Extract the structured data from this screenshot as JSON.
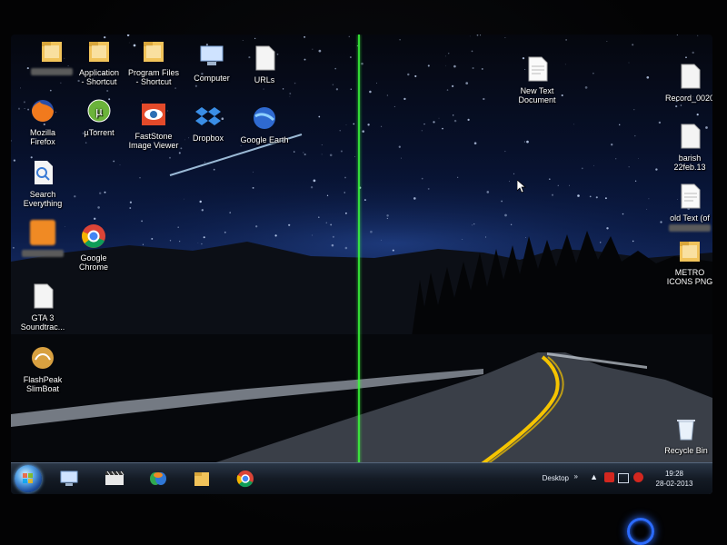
{
  "desktop": {
    "icons_left": [
      {
        "key": "user-folder",
        "label": "",
        "label2": "",
        "icon": "folder-icon",
        "blurred": true
      },
      {
        "key": "application-shortcut",
        "label": "Application",
        "label2": "- Shortcut",
        "icon": "folder-icon",
        "blurred": false
      },
      {
        "key": "program-files-shortcut",
        "label": "Program Files",
        "label2": "- Shortcut",
        "icon": "folder-icon",
        "blurred": false
      },
      {
        "key": "computer",
        "label": "Computer",
        "label2": "",
        "icon": "computer-icon",
        "blurred": false
      },
      {
        "key": "urls",
        "label": "URLs",
        "label2": "",
        "icon": "document-icon",
        "blurred": false
      },
      {
        "key": "mozilla-firefox",
        "label": "Mozilla",
        "label2": "Firefox",
        "icon": "firefox-icon",
        "blurred": false
      },
      {
        "key": "utorrent",
        "label": "µTorrent",
        "label2": "",
        "icon": "utorrent-icon",
        "blurred": false
      },
      {
        "key": "faststone",
        "label": "FastStone",
        "label2": "Image Viewer",
        "icon": "faststone-eye-icon",
        "blurred": false
      },
      {
        "key": "dropbox",
        "label": "Dropbox",
        "label2": "",
        "icon": "dropbox-icon",
        "blurred": false
      },
      {
        "key": "google-earth",
        "label": "Google Earth",
        "label2": "",
        "icon": "google-earth-icon",
        "blurred": false
      },
      {
        "key": "search-everything",
        "label": "Search",
        "label2": "Everything",
        "icon": "search-everything-icon",
        "blurred": false
      },
      {
        "key": "blurred-item",
        "label": "",
        "label2": "",
        "icon": "orange-app-icon",
        "blurred": true
      },
      {
        "key": "google-chrome",
        "label": "Google",
        "label2": "Chrome",
        "icon": "chrome-icon",
        "blurred": false
      },
      {
        "key": "gta3",
        "label": "GTA 3",
        "label2": "Soundtrac...",
        "icon": "document-icon",
        "blurred": false
      },
      {
        "key": "flashpeak",
        "label": "FlashPeak",
        "label2": "SlimBoat",
        "icon": "slimboat-icon",
        "blurred": false
      }
    ],
    "icons_right": [
      {
        "key": "new-text-document",
        "label": "New Text",
        "label2": "Document",
        "icon": "text-document-icon"
      },
      {
        "key": "record",
        "label": "Record_0020",
        "label2": "",
        "icon": "document-icon"
      },
      {
        "key": "barish",
        "label": "barish",
        "label2": "22feb.13",
        "icon": "document-icon"
      },
      {
        "key": "old-text",
        "label": "old Text (of",
        "label2": "",
        "icon": "text-document-icon",
        "blurred": true
      },
      {
        "key": "metro-icons",
        "label": "METRO",
        "label2": "ICONS PNG",
        "icon": "folder-icon"
      },
      {
        "key": "recycle-bin",
        "label": "Recycle Bin",
        "label2": "",
        "icon": "recycle-bin-icon"
      }
    ]
  },
  "taskbar": {
    "pinned": [
      {
        "name": "start-button",
        "icon": "windows-orb-icon"
      },
      {
        "name": "computer",
        "icon": "computer-icon"
      },
      {
        "name": "media",
        "icon": "film-icon"
      },
      {
        "name": "messenger",
        "icon": "messenger-icon"
      },
      {
        "name": "explorer",
        "icon": "folder-icon"
      },
      {
        "name": "chrome",
        "icon": "chrome-icon"
      }
    ],
    "tray": {
      "desktop_label": "Desktop",
      "time": "19:28",
      "date": "28-02-2013"
    }
  },
  "colors": {
    "glitch_line": "#3cff3c",
    "road_line": "#f5c400",
    "taskbar": "#141b25",
    "power_led": "#2b6bff"
  }
}
